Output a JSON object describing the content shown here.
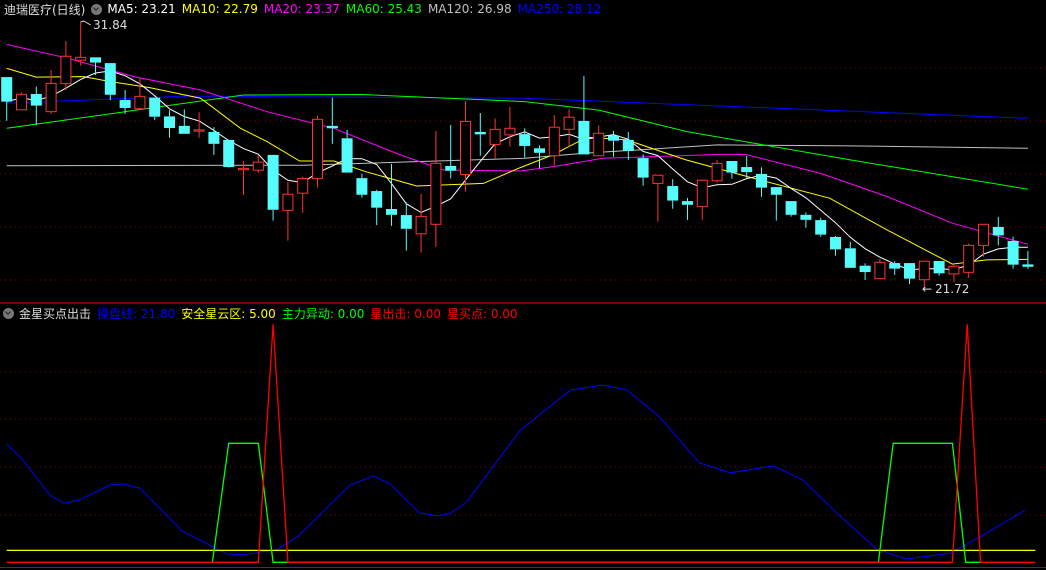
{
  "main_panel": {
    "title": "迪瑞医疗(日线)",
    "legend": [
      {
        "label": "MA5: 23.21",
        "color": "#FFFFFF"
      },
      {
        "label": "MA10: 22.79",
        "color": "#FFFF00"
      },
      {
        "label": "MA20: 23.37",
        "color": "#FF00FF"
      },
      {
        "label": "MA60: 25.43",
        "color": "#00FF00"
      },
      {
        "label": "MA120: 26.98",
        "color": "#C0C0C0"
      },
      {
        "label": "MA250: 28.12",
        "color": "#0000FF"
      }
    ],
    "high_label": "31.84",
    "low_label": "21.72",
    "low_arrow": "←"
  },
  "indicator_panel": {
    "title": "金星买点出击",
    "legend": [
      {
        "label": "操盘线: 21.80",
        "color": "#0000FF"
      },
      {
        "label": "安全星云区: 5.00",
        "color": "#FFFF00"
      },
      {
        "label": "主力异动: 0.00",
        "color": "#00FF00"
      },
      {
        "label": "星出击: 0.00",
        "color": "#FF0000"
      },
      {
        "label": "星买点: 0.00",
        "color": "#FF0000"
      }
    ]
  },
  "colors": {
    "up": "#FF3232",
    "down": "#54FCFC",
    "grid": "#8B0000",
    "separator": "#C00000"
  },
  "chart_data": [
    {
      "type": "candlestick",
      "title": "迪瑞医疗(日线)",
      "ylim": [
        21.72,
        31.84
      ],
      "ohlc": [
        [
          29.74,
          29.74,
          28.08,
          28.81
        ],
        [
          28.5,
          29.16,
          28.5,
          29.09
        ],
        [
          29.1,
          29.38,
          27.92,
          28.66
        ],
        [
          28.43,
          30.01,
          28.35,
          29.5
        ],
        [
          29.49,
          31.11,
          29.25,
          30.53
        ],
        [
          30.38,
          31.84,
          30.17,
          30.49
        ],
        [
          30.49,
          30.49,
          29.82,
          30.29
        ],
        [
          30.27,
          30.27,
          28.87,
          29.07
        ],
        [
          28.87,
          29.25,
          28.35,
          28.57
        ],
        [
          28.54,
          29.7,
          28.54,
          29.01
        ],
        [
          28.96,
          28.96,
          28.11,
          28.24
        ],
        [
          28.25,
          28.49,
          27.44,
          27.81
        ],
        [
          27.89,
          28.52,
          27.59,
          27.59
        ],
        [
          27.69,
          28.41,
          27.44,
          27.74
        ],
        [
          27.66,
          27.84,
          26.79,
          27.21
        ],
        [
          27.36,
          27.36,
          26.31,
          26.33
        ],
        [
          26.23,
          26.56,
          25.27,
          26.28
        ],
        [
          26.21,
          26.79,
          26.11,
          26.52
        ],
        [
          26.79,
          26.79,
          24.3,
          24.71
        ],
        [
          24.69,
          25.77,
          23.54,
          25.3
        ],
        [
          25.34,
          25.96,
          24.6,
          25.9
        ],
        [
          25.9,
          28.27,
          25.55,
          28.14
        ],
        [
          27.89,
          28.96,
          27.21,
          27.8
        ],
        [
          27.42,
          27.74,
          26.12,
          26.12
        ],
        [
          25.91,
          26.07,
          25.17,
          25.28
        ],
        [
          25.42,
          25.47,
          24.13,
          24.79
        ],
        [
          24.74,
          26.45,
          24.1,
          24.52
        ],
        [
          24.51,
          24.99,
          23.16,
          23.99
        ],
        [
          23.8,
          25.31,
          23.08,
          24.46
        ],
        [
          24.16,
          27.7,
          23.31,
          26.47
        ],
        [
          26.37,
          27.92,
          25.9,
          26.19
        ],
        [
          26.05,
          28.83,
          25.4,
          28.06
        ],
        [
          27.66,
          28.38,
          26.76,
          27.57
        ],
        [
          27.19,
          28.18,
          26.66,
          27.76
        ],
        [
          27.55,
          28.61,
          27.1,
          27.8
        ],
        [
          27.58,
          27.8,
          26.69,
          27.13
        ],
        [
          27.04,
          27.15,
          26.28,
          26.87
        ],
        [
          26.76,
          28.3,
          26.38,
          27.84
        ],
        [
          27.76,
          28.52,
          27.1,
          28.22
        ],
        [
          28.08,
          29.78,
          26.81,
          26.81
        ],
        [
          26.76,
          27.91,
          26.76,
          27.61
        ],
        [
          27.53,
          27.7,
          26.72,
          27.33
        ],
        [
          27.36,
          27.66,
          26.6,
          26.94
        ],
        [
          26.67,
          26.81,
          25.62,
          25.93
        ],
        [
          25.71,
          26.02,
          24.26,
          26.02
        ],
        [
          25.61,
          25.87,
          24.75,
          25.06
        ],
        [
          25.04,
          25.16,
          24.33,
          24.9
        ],
        [
          24.83,
          25.87,
          24.33,
          25.83
        ],
        [
          25.81,
          26.6,
          25.74,
          26.47
        ],
        [
          26.56,
          26.56,
          25.89,
          26.12
        ],
        [
          26.33,
          26.75,
          25.89,
          26.14
        ],
        [
          26.07,
          26.32,
          25.2,
          25.55
        ],
        [
          25.57,
          25.57,
          24.3,
          25.28
        ],
        [
          25.04,
          25.04,
          24.45,
          24.52
        ],
        [
          24.52,
          24.61,
          24.03,
          24.33
        ],
        [
          24.32,
          24.41,
          23.69,
          23.77
        ],
        [
          23.68,
          23.72,
          22.97,
          23.21
        ],
        [
          23.25,
          23.5,
          22.51,
          22.51
        ],
        [
          22.59,
          22.68,
          22.05,
          22.35
        ],
        [
          22.1,
          22.85,
          22.1,
          22.72
        ],
        [
          22.69,
          22.76,
          22.24,
          22.48
        ],
        [
          22.69,
          22.69,
          21.89,
          22.1
        ],
        [
          22.06,
          22.76,
          21.72,
          22.76
        ],
        [
          22.77,
          22.77,
          22.21,
          22.3
        ],
        [
          22.28,
          22.62,
          21.98,
          22.57
        ],
        [
          22.34,
          23.44,
          22.13,
          23.36
        ],
        [
          23.36,
          24.16,
          22.93,
          24.16
        ],
        [
          24.06,
          24.44,
          23.36,
          23.74
        ],
        [
          23.53,
          23.69,
          22.48,
          22.63
        ],
        [
          22.64,
          23.15,
          22.47,
          22.55
        ]
      ],
      "ma_series": [
        {
          "name": "MA10",
          "color": "#FFFF00",
          "points": [
            [
              0,
              30.07
            ],
            [
              2,
              29.74
            ],
            [
              5.2,
              29.76
            ],
            [
              7,
              29.57
            ],
            [
              9.7,
              29.34
            ],
            [
              13.1,
              28.94
            ],
            [
              15.8,
              27.8
            ],
            [
              17.6,
              27.29
            ],
            [
              19.8,
              26.56
            ],
            [
              22.1,
              26.56
            ],
            [
              24.3,
              26.15
            ],
            [
              27.7,
              25.61
            ],
            [
              32.2,
              25.71
            ],
            [
              34.7,
              26.31
            ],
            [
              36.9,
              26.79
            ],
            [
              39.2,
              27.46
            ],
            [
              41.9,
              27.36
            ],
            [
              45.9,
              26.6
            ],
            [
              50.9,
              25.84
            ],
            [
              55.6,
              25.15
            ],
            [
              59.5,
              23.94
            ],
            [
              63.9,
              22.65
            ],
            [
              66.2,
              22.81
            ],
            [
              69,
              22.83
            ]
          ]
        },
        {
          "name": "MA20",
          "color": "#FF00FF",
          "points": [
            [
              0,
              30.98
            ],
            [
              4,
              30.47
            ],
            [
              8.6,
              29.76
            ],
            [
              13.1,
              29.25
            ],
            [
              17.6,
              28.43
            ],
            [
              22.1,
              27.8
            ],
            [
              26.6,
              26.79
            ],
            [
              29.5,
              26.22
            ],
            [
              34.7,
              26.18
            ],
            [
              36.9,
              26.34
            ],
            [
              40.3,
              26.66
            ],
            [
              48.2,
              26.81
            ],
            [
              49.9,
              26.81
            ],
            [
              55,
              26.09
            ],
            [
              59.5,
              25.21
            ],
            [
              63.9,
              24.2
            ],
            [
              69,
              23.4
            ]
          ]
        },
        {
          "name": "MA60",
          "color": "#00FF00",
          "points": [
            [
              0,
              27.8
            ],
            [
              8,
              28.43
            ],
            [
              16,
              29.06
            ],
            [
              24,
              29.08
            ],
            [
              35,
              28.81
            ],
            [
              40,
              28.49
            ],
            [
              46,
              27.67
            ],
            [
              57,
              26.6
            ],
            [
              69,
              25.49
            ]
          ]
        },
        {
          "name": "MA120",
          "color": "#C0C0C0",
          "points": [
            [
              0,
              26.38
            ],
            [
              20,
              26.4
            ],
            [
              35,
              26.66
            ],
            [
              39,
              26.85
            ],
            [
              48,
              27.17
            ],
            [
              57,
              27.13
            ],
            [
              69,
              27.04
            ]
          ]
        },
        {
          "name": "MA250",
          "color": "#0000FF",
          "points": [
            [
              0,
              28.75
            ],
            [
              12,
              29.02
            ],
            [
              35,
              28.94
            ],
            [
              69,
              28.18
            ]
          ]
        }
      ]
    },
    {
      "type": "line",
      "title": "金星买点出击",
      "ylim": [
        0,
        100
      ],
      "series": [
        {
          "name": "操盘线",
          "color": "#0000FF",
          "points": [
            [
              0,
              49.7
            ],
            [
              1.1,
              43
            ],
            [
              2.9,
              28.3
            ],
            [
              3.9,
              24.8
            ],
            [
              4.9,
              26.2
            ],
            [
              7,
              32.5
            ],
            [
              7.9,
              32.9
            ],
            [
              9,
              31.1
            ],
            [
              11.9,
              12.9
            ],
            [
              14.9,
              3.5
            ],
            [
              16,
              3.1
            ],
            [
              18.3,
              5.5
            ],
            [
              19.8,
              11.5
            ],
            [
              23.2,
              32.5
            ],
            [
              24.8,
              36.3
            ],
            [
              25.9,
              32.9
            ],
            [
              27.9,
              20.8
            ],
            [
              29.1,
              19.5
            ],
            [
              30,
              20.6
            ],
            [
              31.1,
              25.5
            ],
            [
              34.7,
              55.6
            ],
            [
              38.1,
              72.4
            ],
            [
              40.3,
              74.5
            ],
            [
              41.9,
              72.4
            ],
            [
              44.1,
              61.2
            ],
            [
              46.8,
              41.8
            ],
            [
              48.9,
              37.6
            ],
            [
              51.8,
              40.5
            ],
            [
              53.8,
              34.6
            ],
            [
              56.1,
              20.6
            ],
            [
              58.8,
              5.5
            ],
            [
              60.8,
              1.4
            ],
            [
              63.7,
              3.8
            ],
            [
              65.8,
              10.8
            ],
            [
              68.8,
              21.8
            ]
          ]
        },
        {
          "name": "安全星云区",
          "color": "#FFFF00",
          "points": [
            [
              0,
              5
            ],
            [
              69.5,
              5
            ]
          ]
        },
        {
          "name": "主力异动",
          "color": "#00FF00",
          "points": [
            [
              13.9,
              0
            ],
            [
              15,
              50
            ],
            [
              17,
              50
            ],
            [
              18,
              0
            ],
            [
              19,
              0
            ],
            [
              58.9,
              0
            ],
            [
              59.9,
              50
            ],
            [
              63.9,
              50
            ],
            [
              64.8,
              0
            ],
            [
              65.8,
              0
            ]
          ]
        },
        {
          "name": "星出击",
          "color": "#FF0000",
          "points": [
            [
              0,
              0
            ],
            [
              17,
              0
            ],
            [
              18,
              100
            ],
            [
              19,
              0
            ],
            [
              63.9,
              0
            ],
            [
              64.9,
              100
            ],
            [
              65.8,
              0
            ],
            [
              69.5,
              0
            ]
          ]
        }
      ]
    }
  ]
}
